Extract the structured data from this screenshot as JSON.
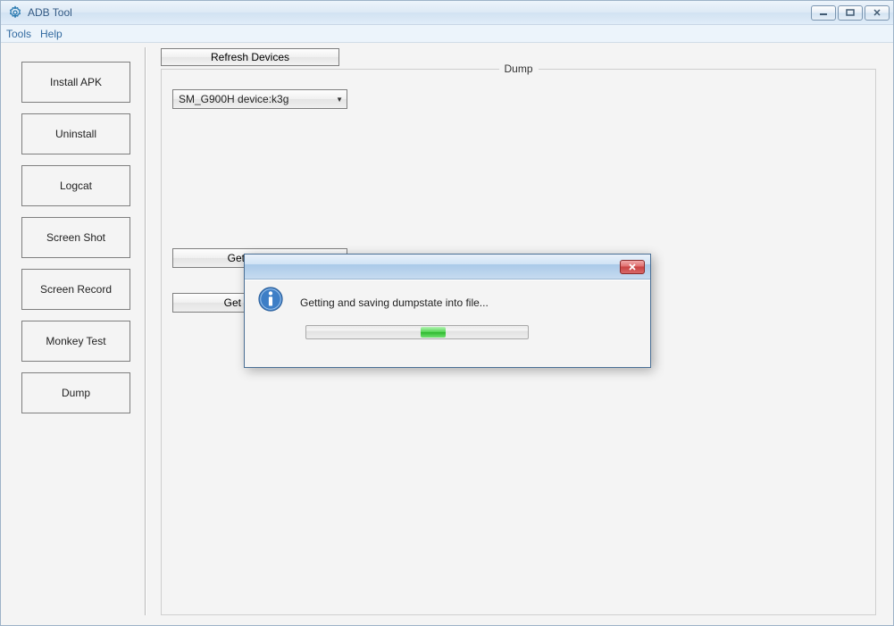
{
  "window": {
    "title": "ADB Tool",
    "icon": "gear-icon"
  },
  "menu": {
    "tools": "Tools",
    "help": "Help"
  },
  "sidebar": {
    "items": [
      "Install APK",
      "Uninstall",
      "Logcat",
      "Screen Shot",
      "Screen Record",
      "Monkey Test",
      "Dump"
    ]
  },
  "main": {
    "refresh_label": "Refresh Devices",
    "group_label": "Dump",
    "device_selected": "SM_G900H device:k3g",
    "get_dumpsys_label": "Get Dumpsys",
    "get_dumpstate_label": "Get Dumpstate"
  },
  "dialog": {
    "message": "Getting and saving dumpstate into file...",
    "progress_mode": "marquee"
  }
}
